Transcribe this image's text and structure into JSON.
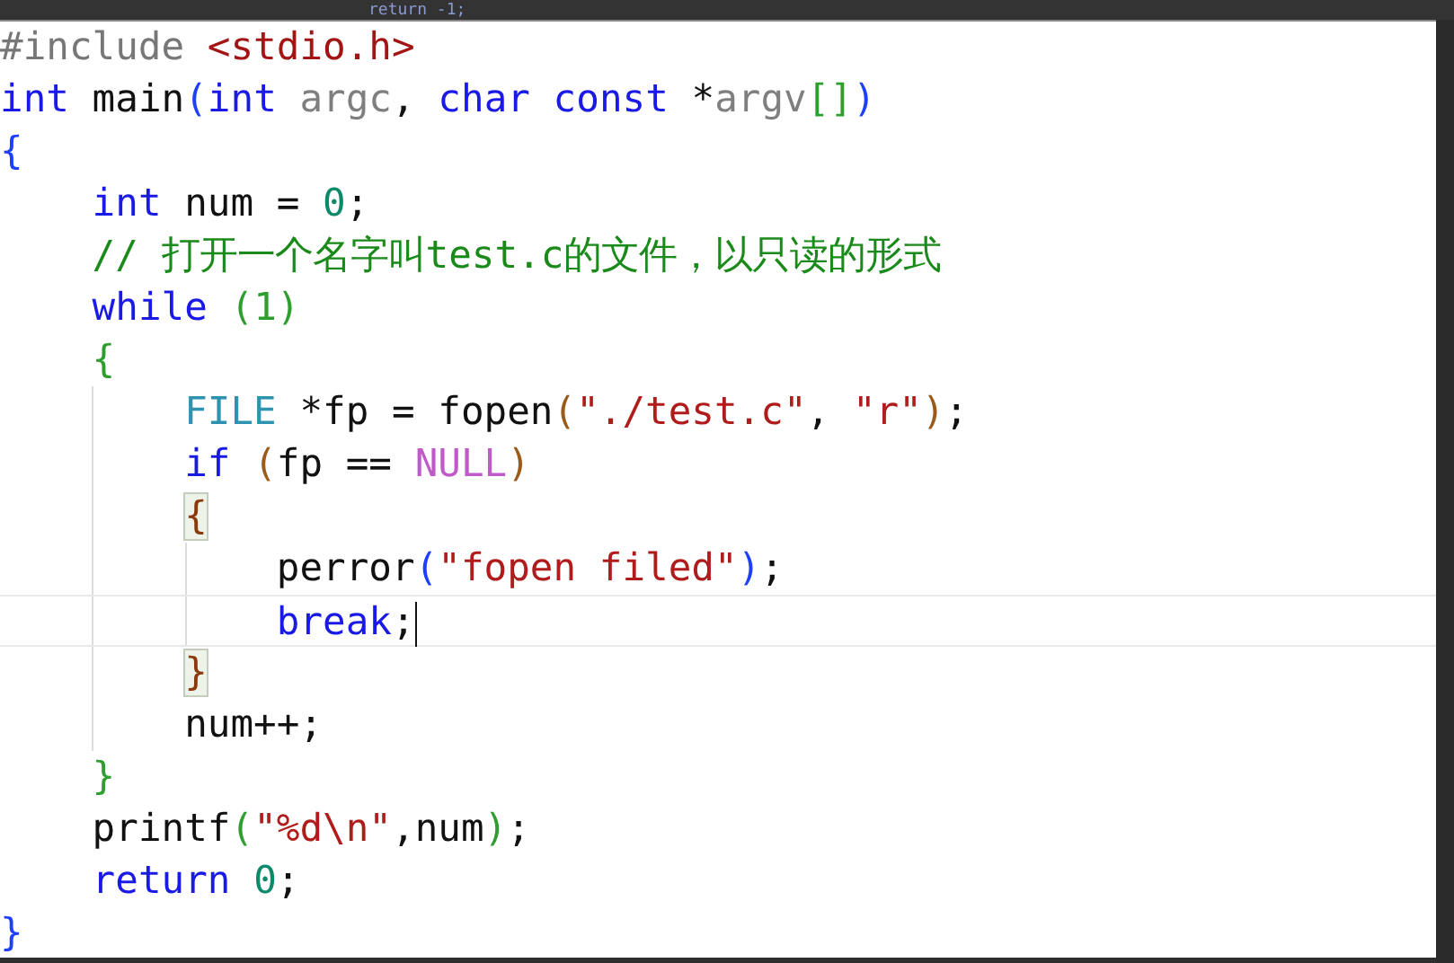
{
  "background_editor": {
    "line": "return -1;"
  },
  "editor": {
    "lines": [
      {
        "tokens": [
          {
            "kind": "preproc",
            "text": "#include "
          },
          {
            "kind": "header",
            "text": "<stdio.h>"
          }
        ]
      },
      {
        "tokens": [
          {
            "kind": "keyword",
            "text": "int"
          },
          {
            "kind": "plain",
            "text": " main"
          },
          {
            "kind": "bracket",
            "text": "(",
            "color": "#1f3fff"
          },
          {
            "kind": "keyword",
            "text": "int"
          },
          {
            "kind": "param",
            "text": " argc"
          },
          {
            "kind": "plain",
            "text": ", "
          },
          {
            "kind": "keyword",
            "text": "char"
          },
          {
            "kind": "keyword",
            "text": " const"
          },
          {
            "kind": "plain",
            "text": " *"
          },
          {
            "kind": "param",
            "text": "argv"
          },
          {
            "kind": "bracket",
            "text": "[]",
            "color": "#2e9e2e"
          },
          {
            "kind": "bracket",
            "text": ")",
            "color": "#1f3fff"
          }
        ]
      },
      {
        "tokens": [
          {
            "kind": "bracket",
            "text": "{",
            "color": "#1f3fff"
          }
        ]
      },
      {
        "tokens": [
          {
            "kind": "keyword",
            "text": "    int"
          },
          {
            "kind": "plain",
            "text": " num = "
          },
          {
            "kind": "number",
            "text": "0"
          },
          {
            "kind": "plain",
            "text": ";"
          }
        ]
      },
      {
        "tokens": [
          {
            "kind": "comment",
            "text": "    // 打开一个名字叫test.c的文件，以只读的形式"
          }
        ]
      },
      {
        "tokens": [
          {
            "kind": "keyword",
            "text": "    while"
          },
          {
            "kind": "bracket",
            "text": " (",
            "color": "#2e9e2e"
          },
          {
            "kind": "bracket",
            "text": "1",
            "color": "#2e9e2e"
          },
          {
            "kind": "bracket",
            "text": ")",
            "color": "#2e9e2e"
          }
        ]
      },
      {
        "tokens": [
          {
            "kind": "bracket",
            "text": "    {",
            "color": "#2e9e2e"
          }
        ]
      },
      {
        "tokens": [
          {
            "kind": "type",
            "text": "        FILE"
          },
          {
            "kind": "plain",
            "text": " *fp = fopen"
          },
          {
            "kind": "bracket",
            "text": "(",
            "color": "#9a5a1a"
          },
          {
            "kind": "string",
            "text": "\"./test.c\""
          },
          {
            "kind": "plain",
            "text": ", "
          },
          {
            "kind": "string",
            "text": "\"r\""
          },
          {
            "kind": "bracket",
            "text": ")",
            "color": "#9a5a1a"
          },
          {
            "kind": "plain",
            "text": ";"
          }
        ]
      },
      {
        "tokens": [
          {
            "kind": "keyword",
            "text": "        if"
          },
          {
            "kind": "bracket",
            "text": " (",
            "color": "#9a5a1a"
          },
          {
            "kind": "plain",
            "text": "fp == "
          },
          {
            "kind": "macro",
            "text": "NULL"
          },
          {
            "kind": "bracket",
            "text": ")",
            "color": "#9a5a1a"
          }
        ]
      },
      {
        "tokens": [
          {
            "kind": "bracket",
            "text": "        {",
            "color": "#8b3a0e",
            "matched": true
          }
        ]
      },
      {
        "tokens": [
          {
            "kind": "plain",
            "text": "            perror"
          },
          {
            "kind": "bracket",
            "text": "(",
            "color": "#1f3fff"
          },
          {
            "kind": "string",
            "text": "\"fopen filed\""
          },
          {
            "kind": "bracket",
            "text": ")",
            "color": "#1f3fff"
          },
          {
            "kind": "plain",
            "text": ";"
          }
        ]
      },
      {
        "current": true,
        "cursor": true,
        "tokens": [
          {
            "kind": "keyword",
            "text": "            break"
          },
          {
            "kind": "plain",
            "text": ";"
          }
        ]
      },
      {
        "tokens": [
          {
            "kind": "bracket",
            "text": "        }",
            "color": "#8b3a0e",
            "matched": true
          }
        ]
      },
      {
        "tokens": [
          {
            "kind": "plain",
            "text": "        num++;"
          }
        ]
      },
      {
        "tokens": [
          {
            "kind": "bracket",
            "text": "    }",
            "color": "#2e9e2e"
          }
        ]
      },
      {
        "tokens": [
          {
            "kind": "plain",
            "text": "    printf"
          },
          {
            "kind": "bracket",
            "text": "(",
            "color": "#2e9e2e"
          },
          {
            "kind": "string",
            "text": "\"%d\\n\""
          },
          {
            "kind": "plain",
            "text": ",num"
          },
          {
            "kind": "bracket",
            "text": ")",
            "color": "#2e9e2e"
          },
          {
            "kind": "plain",
            "text": ";"
          }
        ]
      },
      {
        "tokens": [
          {
            "kind": "keyword",
            "text": "    return"
          },
          {
            "kind": "number",
            "text": " 0"
          },
          {
            "kind": "plain",
            "text": ";"
          }
        ]
      },
      {
        "tokens": [
          {
            "kind": "bracket",
            "text": "}",
            "color": "#1f3fff"
          }
        ]
      }
    ]
  }
}
